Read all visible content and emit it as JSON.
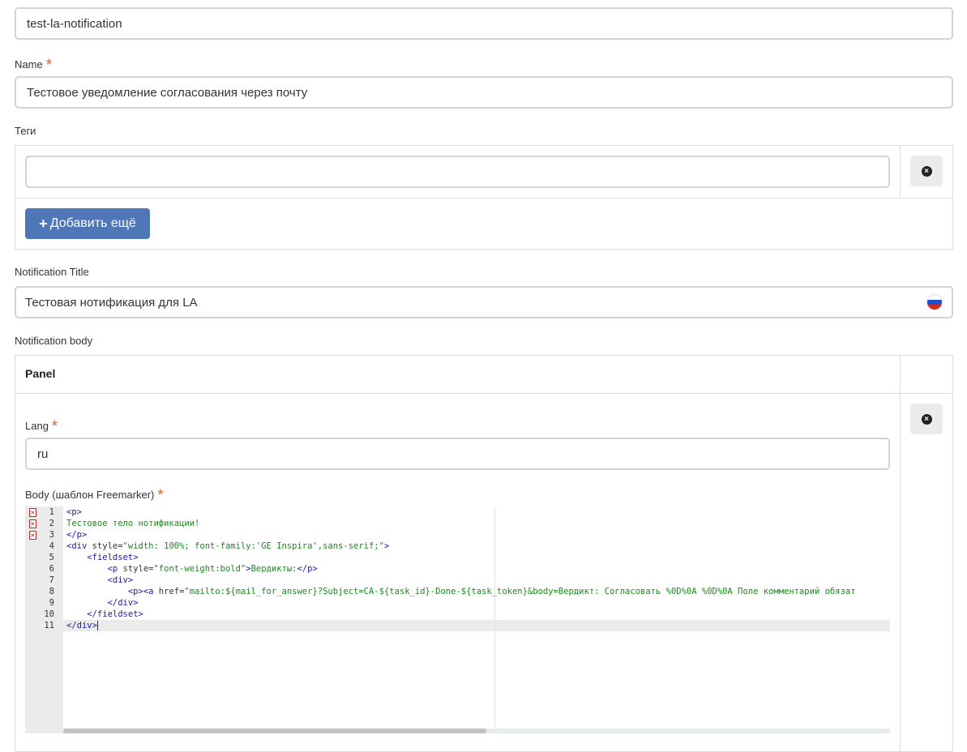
{
  "fields": {
    "id_value": "test-la-notification",
    "name_label": "Name",
    "name_value": "Тестовое уведомление согласования через почту",
    "tags_label": "Теги",
    "tags_value": "",
    "add_more_label": "Добавить ещё",
    "title_label": "Notification Title",
    "title_value": "Тестовая нотификация для LA",
    "body_label": "Notification body"
  },
  "required_marker": "*",
  "panel": {
    "header": "Panel",
    "lang_label": "Lang",
    "lang_value": "ru",
    "template_label": "Body (шаблон Freemarker)"
  },
  "editor": {
    "error_lines": [
      1,
      2,
      3
    ],
    "active_line": 11,
    "lines": [
      {
        "n": "1",
        "parts": [
          [
            "tag",
            "<p>"
          ]
        ]
      },
      {
        "n": "2",
        "parts": [
          [
            "txt",
            "Тестовое тело нотификации!"
          ]
        ]
      },
      {
        "n": "3",
        "parts": [
          [
            "tag",
            "</p>"
          ]
        ]
      },
      {
        "n": "4",
        "parts": [
          [
            "tag",
            "<div "
          ],
          [
            "attr",
            "style="
          ],
          [
            "val",
            "\"width: 100%; font-family:'GE Inspira',sans-serif;\""
          ],
          [
            "tag",
            ">"
          ]
        ]
      },
      {
        "n": "5",
        "parts": [
          [
            "ind",
            "    "
          ],
          [
            "tag",
            "<fieldset>"
          ]
        ]
      },
      {
        "n": "6",
        "parts": [
          [
            "ind",
            "        "
          ],
          [
            "tag",
            "<p "
          ],
          [
            "attr",
            "style="
          ],
          [
            "val",
            "\"font-weight:bold\""
          ],
          [
            "tag",
            ">"
          ],
          [
            "txt",
            "Вердикты:"
          ],
          [
            "tag",
            "</p>"
          ]
        ]
      },
      {
        "n": "7",
        "parts": [
          [
            "ind",
            "        "
          ],
          [
            "tag",
            "<div>"
          ]
        ]
      },
      {
        "n": "8",
        "parts": [
          [
            "ind",
            "            "
          ],
          [
            "tag",
            "<p><a "
          ],
          [
            "attr",
            "href="
          ],
          [
            "val",
            "\"mailto:${mail_for_answer}?Subject=CA-${task_id}-Done-${task_token}&body=Вердикт: Согласовать %0D%0A %0D%0A Поле комментарий обязат"
          ]
        ]
      },
      {
        "n": "9",
        "parts": [
          [
            "ind",
            "        "
          ],
          [
            "tag",
            "</div>"
          ]
        ]
      },
      {
        "n": "10",
        "parts": [
          [
            "ind",
            "    "
          ],
          [
            "tag",
            "</fieldset>"
          ]
        ]
      },
      {
        "n": "11",
        "parts": [
          [
            "tag",
            "</div>"
          ]
        ]
      }
    ]
  },
  "icons": {
    "remove": "times-circle-icon",
    "add": "plus-icon",
    "flag": "russia-flag-icon",
    "error": "error-marker-icon"
  },
  "colors": {
    "accent": "#4f77b8",
    "required": "#e8612c",
    "error": "#c62828"
  }
}
